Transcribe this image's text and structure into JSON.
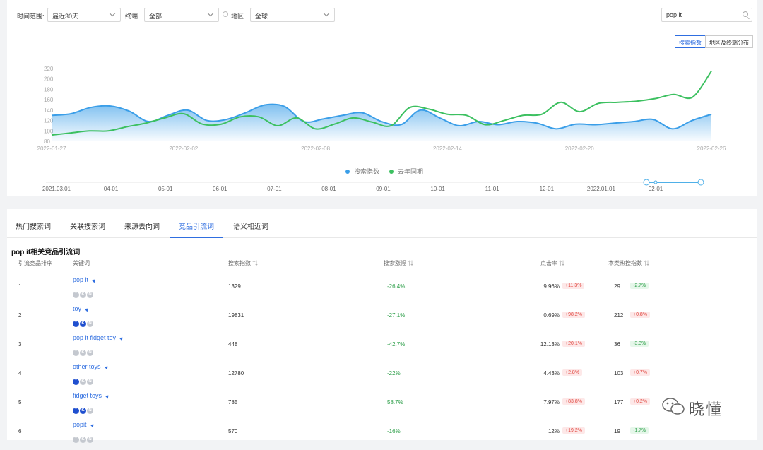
{
  "filters": {
    "time_label": "时间范围:",
    "time_value": "最近30天",
    "channel_label": "终端",
    "channel_value": "全部",
    "region_label": "地区",
    "region_value": "全球",
    "search_value": "pop it"
  },
  "toggles": {
    "index": "搜索指数",
    "region_dist": "地区及终端分布"
  },
  "chart_data": {
    "type": "area",
    "x_labels": [
      "2022-01-27",
      "2022-02-02",
      "2022-02-08",
      "2022-02-14",
      "2022-02-20",
      "2022-02-26"
    ],
    "y_ticks": [
      80,
      100,
      120,
      140,
      160,
      180,
      200,
      220
    ],
    "ylim": [
      80,
      220
    ],
    "series": [
      {
        "name": "搜索指数",
        "color": "#3a9ee8",
        "values": [
          130,
          133,
          145,
          148,
          138,
          118,
          130,
          140,
          120,
          122,
          135,
          150,
          147,
          118,
          123,
          130,
          135,
          118,
          112,
          140,
          125,
          110,
          118,
          112,
          118,
          115,
          104,
          113,
          112,
          115,
          118,
          122,
          104,
          120,
          132
        ]
      },
      {
        "name": "去年同期",
        "color": "#3cc060",
        "values": [
          92,
          96,
          100,
          100,
          108,
          115,
          125,
          133,
          113,
          113,
          127,
          127,
          110,
          125,
          104,
          113,
          125,
          117,
          110,
          145,
          142,
          132,
          130,
          112,
          120,
          130,
          132,
          155,
          137,
          153,
          155,
          157,
          162,
          170,
          165,
          215
        ]
      }
    ],
    "legend": "bottom-center",
    "grid": false
  },
  "timeline": [
    "2021.03.01",
    "04-01",
    "05-01",
    "06-01",
    "07-01",
    "08-01",
    "09-01",
    "10-01",
    "11-01",
    "12-01",
    "2022.01.01",
    "02-01"
  ],
  "tabs": [
    "热门搜索词",
    "关联搜索词",
    "来源去向词",
    "竞品引流词",
    "语义相近词"
  ],
  "active_tab": 3,
  "section_title": "pop it相关竞品引流词",
  "table": {
    "headers": [
      "引流竞品排序",
      "关键词",
      "搜索指数",
      "搜索涨幅",
      "点击率",
      "本类热搜指数"
    ],
    "rows": [
      {
        "rank": "1",
        "keyword": "pop it",
        "index": "1329",
        "growth": "-26.4%",
        "ctr": "9.96%",
        "ctr_delta": "+11.3%",
        "hot": "29",
        "hot_delta": "-2.7%",
        "badges": [
          "off",
          "off",
          "off"
        ]
      },
      {
        "rank": "2",
        "keyword": "toy",
        "index": "19831",
        "growth": "-27.1%",
        "ctr": "0.69%",
        "ctr_delta": "+98.2%",
        "hot": "212",
        "hot_delta": "+0.8%",
        "badges": [
          "on",
          "on",
          "off"
        ]
      },
      {
        "rank": "3",
        "keyword": "pop it fidget toy",
        "index": "448",
        "growth": "-42.7%",
        "ctr": "12.13%",
        "ctr_delta": "+20.1%",
        "hot": "36",
        "hot_delta": "-3.3%",
        "badges": [
          "off",
          "off",
          "off"
        ]
      },
      {
        "rank": "4",
        "keyword": "other toys",
        "index": "12780",
        "growth": "-22%",
        "ctr": "4.43%",
        "ctr_delta": "+2.8%",
        "hot": "103",
        "hot_delta": "+0.7%",
        "badges": [
          "on",
          "off",
          "off"
        ]
      },
      {
        "rank": "5",
        "keyword": "fidget toys",
        "index": "785",
        "growth": "58.7%",
        "ctr": "7.97%",
        "ctr_delta": "+83.8%",
        "hot": "177",
        "hot_delta": "+0.2%",
        "badges": [
          "on",
          "on",
          "off"
        ]
      },
      {
        "rank": "6",
        "keyword": "popit",
        "index": "570",
        "growth": "-16%",
        "ctr": "12%",
        "ctr_delta": "+19.2%",
        "hot": "19",
        "hot_delta": "-1.7%",
        "badges": [
          "off",
          "off",
          "off"
        ]
      }
    ]
  },
  "watermark": "晓懂"
}
